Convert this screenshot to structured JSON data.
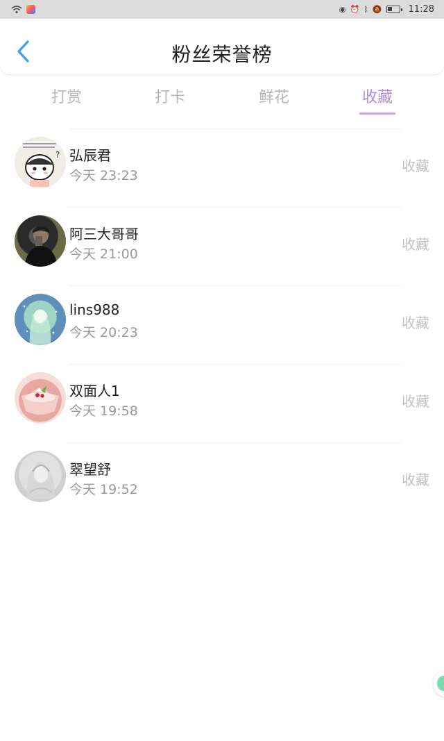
{
  "status_bar": {
    "time": "11:28"
  },
  "header": {
    "title": "粉丝荣誉榜"
  },
  "tabs": [
    {
      "label": "打赏",
      "active": false
    },
    {
      "label": "打卡",
      "active": false
    },
    {
      "label": "鲜花",
      "active": false
    },
    {
      "label": "收藏",
      "active": true
    }
  ],
  "list": [
    {
      "name": "弘辰君",
      "time": "今天 23:23",
      "action": "收藏"
    },
    {
      "name": "阿三大哥哥",
      "time": "今天 21:00",
      "action": "收藏"
    },
    {
      "name": "lins988",
      "time": "今天 20:23",
      "action": "收藏"
    },
    {
      "name": "双面人1",
      "time": "今天 19:58",
      "action": "收藏"
    },
    {
      "name": "翠望舒",
      "time": "今天 19:52",
      "action": "收藏"
    }
  ],
  "colors": {
    "accent": "#b28fd8",
    "back_arrow": "#3aa0ee",
    "muted_text": "#9a9a9a",
    "inactive_tab": "#b7b7b7"
  }
}
